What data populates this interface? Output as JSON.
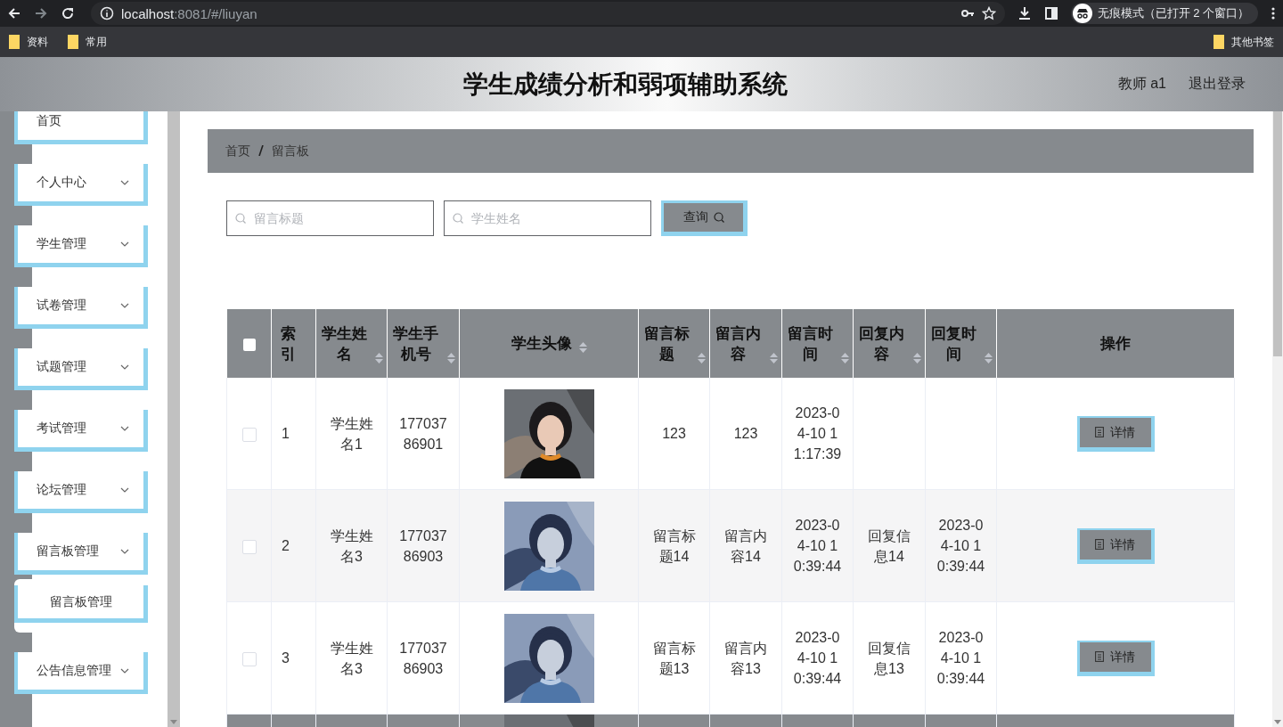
{
  "browser": {
    "url_host": "localhost",
    "url_rest": ":8081/#/liuyan",
    "incognito": "无痕模式（已打开 2 个窗口）",
    "bookmarks": [
      "资料",
      "常用"
    ],
    "other_bookmarks": "其他书签"
  },
  "header": {
    "title": "学生成绩分析和弱项辅助系统",
    "user": "教师 a1",
    "logout": "退出登录"
  },
  "sidebar": {
    "items": [
      {
        "label": "首页",
        "kind": "link"
      },
      {
        "label": "个人中心",
        "kind": "submenu"
      },
      {
        "label": "学生管理",
        "kind": "submenu"
      },
      {
        "label": "试卷管理",
        "kind": "submenu"
      },
      {
        "label": "试题管理",
        "kind": "submenu"
      },
      {
        "label": "考试管理",
        "kind": "submenu"
      },
      {
        "label": "论坛管理",
        "kind": "submenu"
      },
      {
        "label": "留言板管理",
        "kind": "submenu",
        "expanded": true,
        "children": [
          {
            "label": "留言板管理"
          }
        ]
      },
      {
        "label": "公告信息管理",
        "kind": "submenu"
      }
    ]
  },
  "breadcrumb": [
    "首页",
    "留言板"
  ],
  "search": {
    "fields": [
      {
        "placeholder": "留言标题"
      },
      {
        "placeholder": "学生姓名"
      }
    ],
    "button": "查询"
  },
  "table": {
    "select_all": {
      "checked": false
    },
    "columns": [
      {
        "label": "索引",
        "sortable": false
      },
      {
        "label": "学生姓名",
        "sortable": true
      },
      {
        "label": "学生手机号",
        "sortable": true
      },
      {
        "label": "学生头像",
        "sortable": true
      },
      {
        "label": "留言标题",
        "sortable": true
      },
      {
        "label": "留言内容",
        "sortable": true
      },
      {
        "label": "留言时间",
        "sortable": true
      },
      {
        "label": "回复内容",
        "sortable": true
      },
      {
        "label": "回复时间",
        "sortable": true
      },
      {
        "label": "操作",
        "sortable": false
      }
    ],
    "rows": [
      {
        "selected": false,
        "highlighted": false,
        "index": "1",
        "name": "学生姓名1",
        "phone": "17703786901",
        "title": "123",
        "content": "123",
        "time": "2023-04-10 11:17:39",
        "action": "详情"
      },
      {
        "selected": false,
        "highlighted": false,
        "index": "2",
        "name": "学生姓名3",
        "phone": "17703786903",
        "title": "留言标题14",
        "content": "留言内容14",
        "time": "2023-04-10 10:39:44",
        "reply": "回复信息14",
        "reply_time": "2023-04-10 10:39:44",
        "action": "详情"
      },
      {
        "selected": false,
        "highlighted": false,
        "index": "3",
        "name": "学生姓名3",
        "phone": "17703786903",
        "title": "留言标题13",
        "content": "留言内容13",
        "time": "2023-04-10 10:39:44",
        "reply": "回复信息13",
        "reply_time": "2023-04-10 10:39:44",
        "action": "详情"
      },
      {
        "highlighted": true
      }
    ]
  }
}
